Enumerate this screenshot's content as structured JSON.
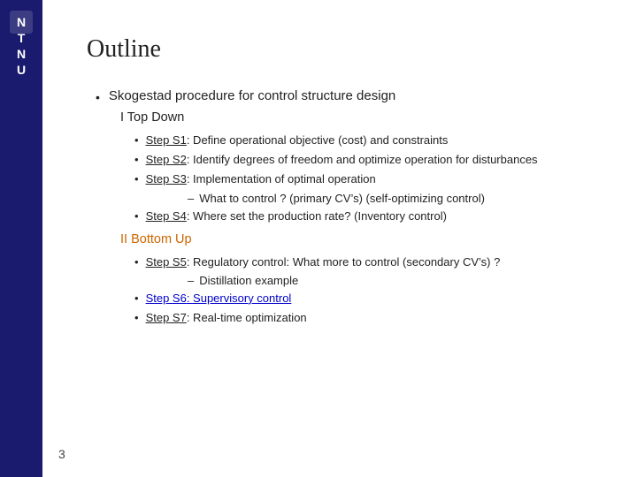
{
  "sidebar": {
    "bg_color": "#1a1a6e"
  },
  "page": {
    "title": "Outline",
    "page_number": "3"
  },
  "content": {
    "main_bullet": "Skogestad procedure for control structure design",
    "section_i": {
      "header": "I  Top Down",
      "sub_items": [
        {
          "prefix": "Step S1",
          "text": ": Define operational objective (cost) and constraints"
        },
        {
          "prefix": "Step S2",
          "text": ": Identify degrees of freedom and optimize operation for disturbances"
        },
        {
          "prefix": "Step S3",
          "text": ": Implementation of optimal operation"
        }
      ],
      "dash_item": "What to control ? (primary CV’s) (self-optimizing control)",
      "step_s4_prefix": "Step S4",
      "step_s4_text": ": Where set the production rate? (Inventory control)"
    },
    "section_ii": {
      "header": "II Bottom Up",
      "sub_items": [
        {
          "prefix": "Step S5",
          "text": ": Regulatory control:  What more to control (secondary CV’s) ?"
        }
      ],
      "dash_item": "Distillation example",
      "step_s6_prefix": "Step S6",
      "step_s6_text": ": Supervisory control",
      "step_s7_prefix": "Step S7",
      "step_s7_text": ": Real-time optimization"
    }
  }
}
